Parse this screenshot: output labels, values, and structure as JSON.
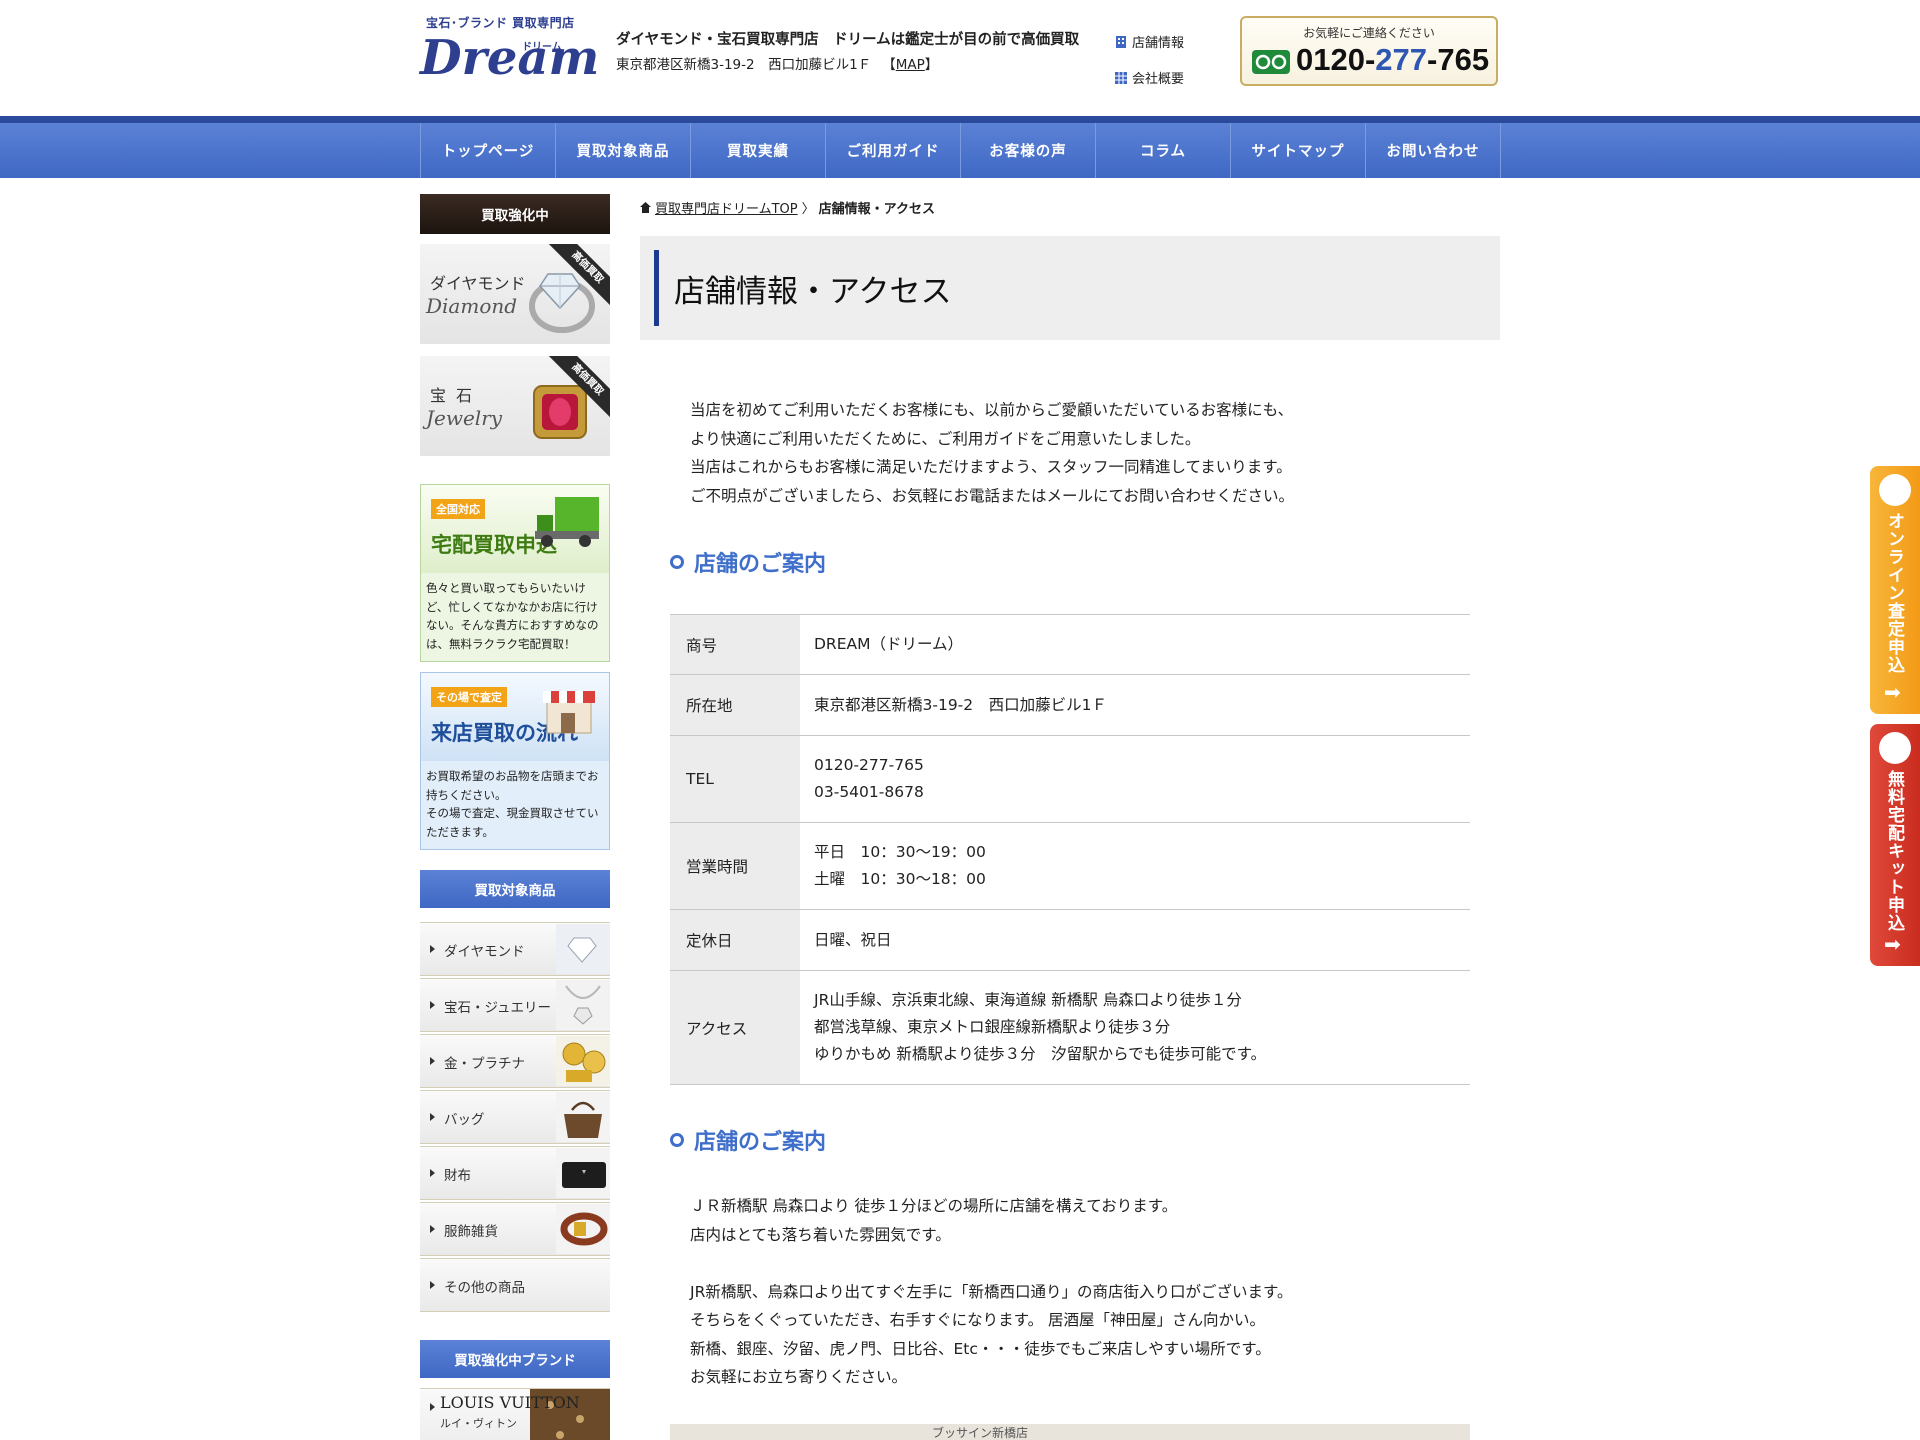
{
  "header": {
    "logo_sub": "宝石･ブランド 買取専門店",
    "logo_main": "Dream",
    "logo_kana": "ドリーム",
    "tagline": "ダイヤモンド・宝石買取専門店　ドリームは鑑定士が目の前で高価買取",
    "address": "東京都港区新橋3-19-2　西口加藤ビル1Ｆ",
    "map_open": "【",
    "map_link": "MAP",
    "map_close": "】",
    "link_store": "店舗情報",
    "link_company": "会社概要",
    "phone_note": "お気軽にご連絡ください",
    "phone_a": "0120-",
    "phone_b": "277",
    "phone_c": "-765"
  },
  "nav": {
    "items": [
      "トップページ",
      "買取対象商品",
      "買取実績",
      "ご利用ガイド",
      "お客様の声",
      "コラム",
      "サイトマップ",
      "お問い合わせ"
    ]
  },
  "sidebar": {
    "head_strong": "買取強化中",
    "promo1": {
      "jp": "ダイヤモンド",
      "en": "Diamond",
      "ribbon": "高価買取"
    },
    "promo2": {
      "jp": "宝石",
      "en": "Jewelry",
      "ribbon": "高価買取"
    },
    "delivery": {
      "tag": "全国対応",
      "title": "宅配買取申込",
      "text": "色々と買い取ってもらいたいけど、忙しくてなかなかお店に行けない。そんな貴方におすすめなのは、無料ラクラク宅配買取！"
    },
    "visit": {
      "tag": "その場で査定",
      "title": "来店買取の流れ",
      "text": "お買取希望のお品物を店頭までお持ちください。\nその場で査定、現金買取させていただきます。"
    },
    "head_items": "買取対象商品",
    "categories": [
      "ダイヤモンド",
      "宝石・ジュエリー",
      "金・プラチナ",
      "バッグ",
      "財布",
      "服飾雑貨",
      "その他の商品"
    ],
    "head_brands": "買取強化中ブランド",
    "brand": {
      "name": "LOUIS VUITTON",
      "kana": "ルイ・ヴィトン"
    }
  },
  "breadcrumb": {
    "home": "買取専門店ドリームTOP",
    "sep": "〉",
    "current": "店舗情報・アクセス"
  },
  "main": {
    "title": "店舗情報・アクセス",
    "intro": [
      "当店を初めてご利用いただくお客様にも、以前からご愛顧いただいているお客様にも、",
      "より快適にご利用いただくために、ご利用ガイドをご用意いたしました。",
      "当店はこれからもお客様に満足いただけますよう、スタッフ一同精進してまいります。",
      "ご不明点がございましたら、お気軽にお電話またはメールにてお問い合わせください。"
    ],
    "section1": "店舗のご案内",
    "table": {
      "name_label": "商号",
      "name_value": "DREAM（ドリーム）",
      "addr_label": "所在地",
      "addr_value": "東京都港区新橋3-19-2　西口加藤ビル1Ｆ",
      "tel_label": "TEL",
      "tel_1": "0120-277-765",
      "tel_2": "03-5401-8678",
      "hours_label": "営業時間",
      "hours_1": "平日　10：30〜19：00",
      "hours_2": "土曜　10：30〜18：00",
      "closed_label": "定休日",
      "closed_value": "日曜、祝日",
      "access_label": "アクセス",
      "access_1": "JR山手線、京浜東北線、東海道線 新橋駅 烏森口より徒歩１分",
      "access_2": "都営浅草線、東京メトロ銀座線新橋駅より徒歩３分",
      "access_3": "ゆりかもめ 新橋駅より徒歩３分　汐留駅からでも徒歩可能です。"
    },
    "section2": "店舗のご案内",
    "access_text": [
      "ＪＲ新橋駅 烏森口より 徒歩１分ほどの場所に店舗を構えております。",
      "店内はとても落ち着いた雰囲気です。",
      "",
      "JR新橋駅、烏森口より出てすぐ左手に「新橋西口通り」の商店街入り口がございます。",
      "そちらをくぐっていただき、右手すぐになります。 居酒屋「神田屋」さん向かい。",
      "新橋、銀座、汐留、虎ノ門、日比谷、Etc・・・徒歩でもご来店しやすい場所です。",
      "お気軽にお立ち寄りください。"
    ],
    "map_label": "ブッサイン新橋店"
  },
  "float": {
    "online": "オンライン査定申込",
    "kit": "無料宅配キット申込"
  }
}
